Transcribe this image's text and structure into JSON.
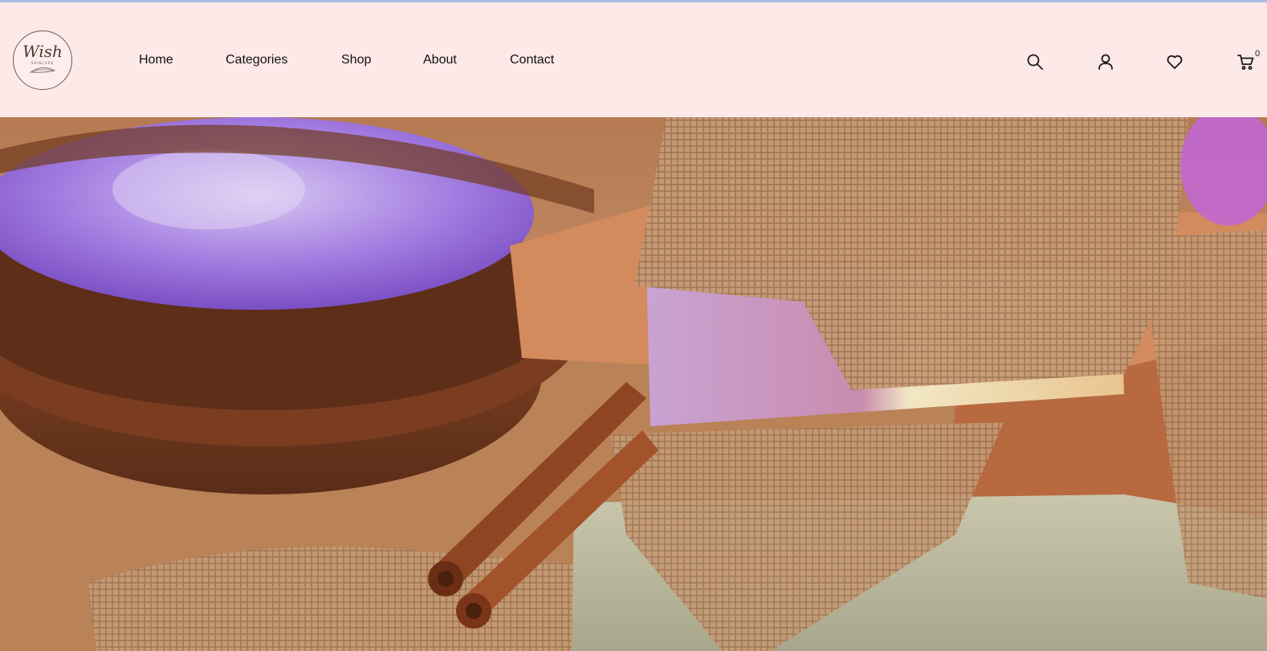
{
  "brand": {
    "name": "Wish",
    "tagline": "SKINCARE"
  },
  "nav": {
    "items": [
      {
        "label": "Home"
      },
      {
        "label": "Categories"
      },
      {
        "label": "Shop"
      },
      {
        "label": "About"
      },
      {
        "label": "Contact"
      }
    ]
  },
  "header_icons": {
    "search": "search-icon",
    "account": "user-icon",
    "wishlist": "heart-icon",
    "cart": "cart-icon",
    "cart_count": "0"
  },
  "hero": {
    "image": "handmade-soap-bars-with-burlap-lavender-salt-cinnamon"
  },
  "colors": {
    "header_bg": "#fde9e8",
    "text": "#111111",
    "top_border": "#a9bfe6"
  }
}
